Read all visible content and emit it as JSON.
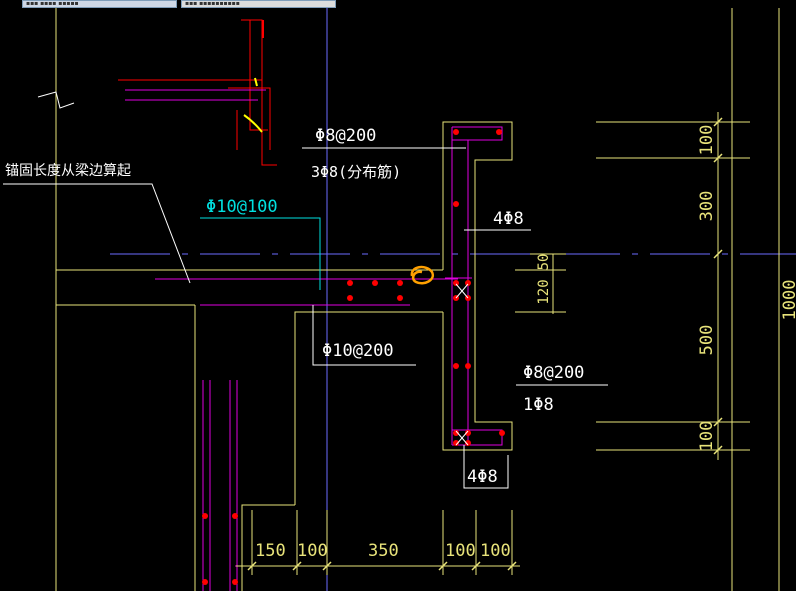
{
  "window": {
    "tabs": [
      {
        "label": "▪▪▪  ▪▪▪▪ ▪▪▪▪▪",
        "active": true
      },
      {
        "label": "▪▪▪  ▪▪▪▪▪▪▪▪▪▪",
        "active": false
      }
    ]
  },
  "drawing": {
    "colors": {
      "background": "#000000",
      "yellow": "#e8e37a",
      "white": "#ffffff",
      "magenta": "#e000e0",
      "red": "#ff0000",
      "cyan": "#00e0e0",
      "blue": "#6b6bff",
      "orange": "#ffa000"
    },
    "annotations": {
      "anchorage_note": "锚固长度从梁边算起",
      "slab_top_bar": "Φ10@100",
      "slab_bottom_bar": "Φ10@200",
      "upstand_stirrup": "Φ8@200",
      "distribution_bar": "3Φ8(分布筋)",
      "top_corner_bars": "4Φ8",
      "lower_stirrup": "Φ8@200",
      "lower_single_bar": "1Φ8",
      "bottom_corner_bars": "4Φ8"
    },
    "dimensions": {
      "vertical": [
        "100",
        "300",
        "50",
        "120",
        "500",
        "100",
        "1000"
      ],
      "horizontal": [
        "150",
        "100",
        "350",
        "100",
        "100"
      ]
    }
  }
}
